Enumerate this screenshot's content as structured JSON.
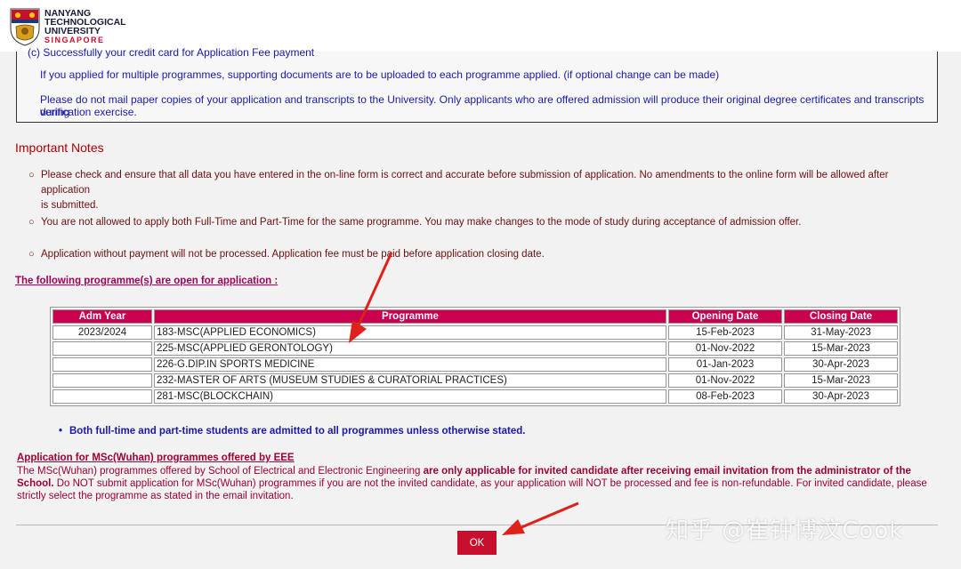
{
  "header": {
    "logo_line1": "NANYANG",
    "logo_line2": "TECHNOLOGICAL",
    "logo_line3": "UNIVERSITY",
    "logo_line4": "SINGAPORE"
  },
  "info_box": {
    "cut_line": "(c)  Successfully your credit card for Application Fee payment",
    "line1": "If you applied for multiple programmes, supporting documents are to be uploaded to each programme applied. (if optional change can be made)",
    "line2": "Please do not mail paper copies of your application and transcripts to the University. Only applicants who are offered admission will produce their original degree certificates and transcripts during",
    "line3": "verification exercise."
  },
  "notes": {
    "title": "Important Notes",
    "items": [
      "Please check and ensure that all data you have entered in the on-line form is correct and accurate before submission of application. No amendments to the online form will be allowed after application",
      "is submitted.",
      "You are not allowed to apply both Full-Time and Part-Time for the same programme. You may make changes to the mode of study during acceptance of admission offer.",
      "Application without payment will not be processed. Application fee must be paid before application closing date."
    ]
  },
  "programmes": {
    "link_text": "The following programme(s) are open for application :",
    "headers": [
      "Adm Year",
      "Programme",
      "Opening Date",
      "Closing Date"
    ],
    "rows": [
      [
        "2023/2024",
        "183-MSC(APPLIED ECONOMICS)",
        "15-Feb-2023",
        "31-May-2023"
      ],
      [
        "",
        "225-MSC(APPLIED GERONTOLOGY)",
        "01-Nov-2022",
        "15-Mar-2023"
      ],
      [
        "",
        "226-G.DIP.IN SPORTS MEDICINE",
        "01-Jan-2023",
        "30-Apr-2023"
      ],
      [
        "",
        "232-MASTER OF ARTS (MUSEUM STUDIES & CURATORIAL PRACTICES)",
        "01-Nov-2022",
        "15-Mar-2023"
      ],
      [
        "",
        "281-MSC(BLOCKCHAIN)",
        "08-Feb-2023",
        "30-Apr-2023"
      ]
    ],
    "mode_note": "Both full-time and part-time students are admitted to all programmes unless otherwise stated."
  },
  "wuhan": {
    "title": "Application for MSc(Wuhan) programmes offered by EEE",
    "body_a": "The MSc(Wuhan) programmes offered by School of Electrical and Electronic Engineering ",
    "body_b": "are only applicable for invited candidate after receiving email invitation from the administrator of the School.",
    "body_c": " Do NOT submit application for MSc(Wuhan) programmes if you are not the invited candidate, as your application will NOT be processed and fee is non-refundable. For invited candidate, please strictly select the programme as stated in the email invitation."
  },
  "actions": {
    "ok_label": "OK"
  },
  "watermark": "知乎 @崔钟博汶Cook",
  "colors": {
    "accent": "#c8004e",
    "info_text": "#1a1aa8",
    "notes_text": "#6b1010",
    "arrow": "#e0201a"
  }
}
